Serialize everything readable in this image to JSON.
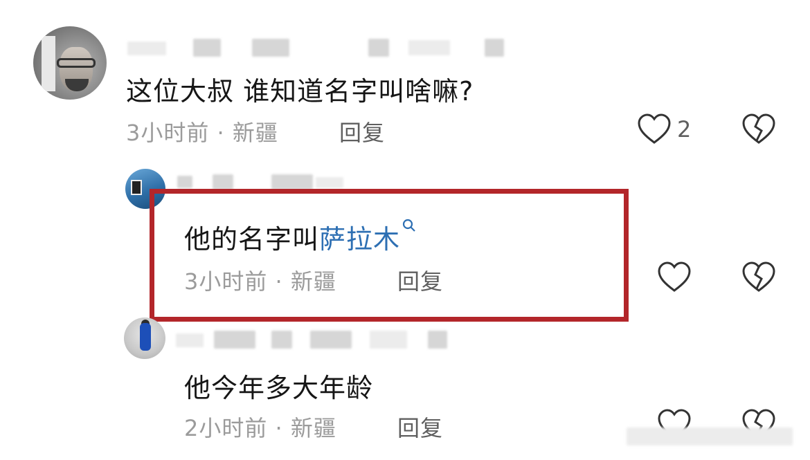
{
  "comments": [
    {
      "text": "这位大叔 谁知道名字叫啥嘛?",
      "time_location": "3小时前 · 新疆",
      "reply_label": "回复",
      "like_count": "2"
    },
    {
      "text_prefix": "他的名字叫",
      "text_link": "萨拉木",
      "time_location": "3小时前 · 新疆",
      "reply_label": "回复"
    },
    {
      "text": "他今年多大年龄",
      "time_location": "2小时前 · 新疆",
      "reply_label": "回复"
    }
  ],
  "colors": {
    "highlight_border": "#b3262a",
    "link": "#2d6fb3",
    "meta": "#9b9b9b"
  },
  "icons": {
    "like": "heart-outline-icon",
    "dislike": "broken-heart-icon",
    "search": "search-icon"
  }
}
